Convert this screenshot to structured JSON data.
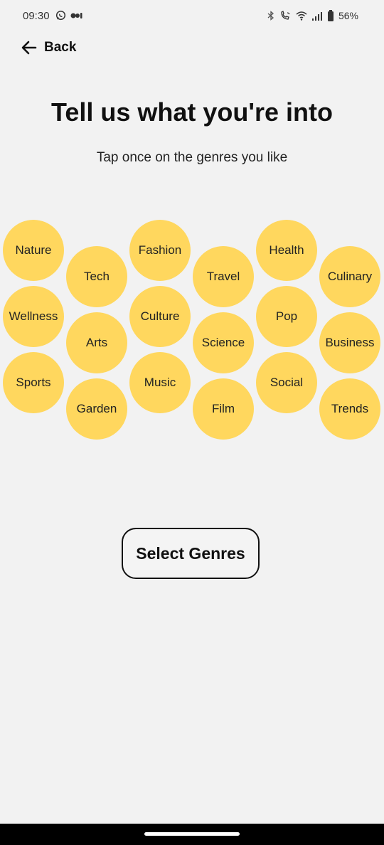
{
  "status_bar": {
    "time": "09:30",
    "battery": "56%",
    "left_icons": [
      "whatsapp-icon",
      "meet-icon"
    ],
    "right_icons": [
      "bluetooth-icon",
      "wifi-call-icon",
      "wifi-icon",
      "signal-icon",
      "battery-icon"
    ]
  },
  "header": {
    "back_label": "Back"
  },
  "main": {
    "title": "Tell us what you're into",
    "subtitle": "Tap once on the genres you like"
  },
  "genres": [
    "Nature",
    "Tech",
    "Fashion",
    "Travel",
    "Health",
    "Culinary",
    "Wellness",
    "Arts",
    "Culture",
    "Science",
    "Pop",
    "Business",
    "Sports",
    "Garden",
    "Music",
    "Film",
    "Social",
    "Trends"
  ],
  "actions": {
    "select_label": "Select Genres"
  },
  "colors": {
    "background": "#f2f2f2",
    "bubble": "#ffd75e",
    "text": "#111111",
    "nav_bar": "#000000"
  }
}
